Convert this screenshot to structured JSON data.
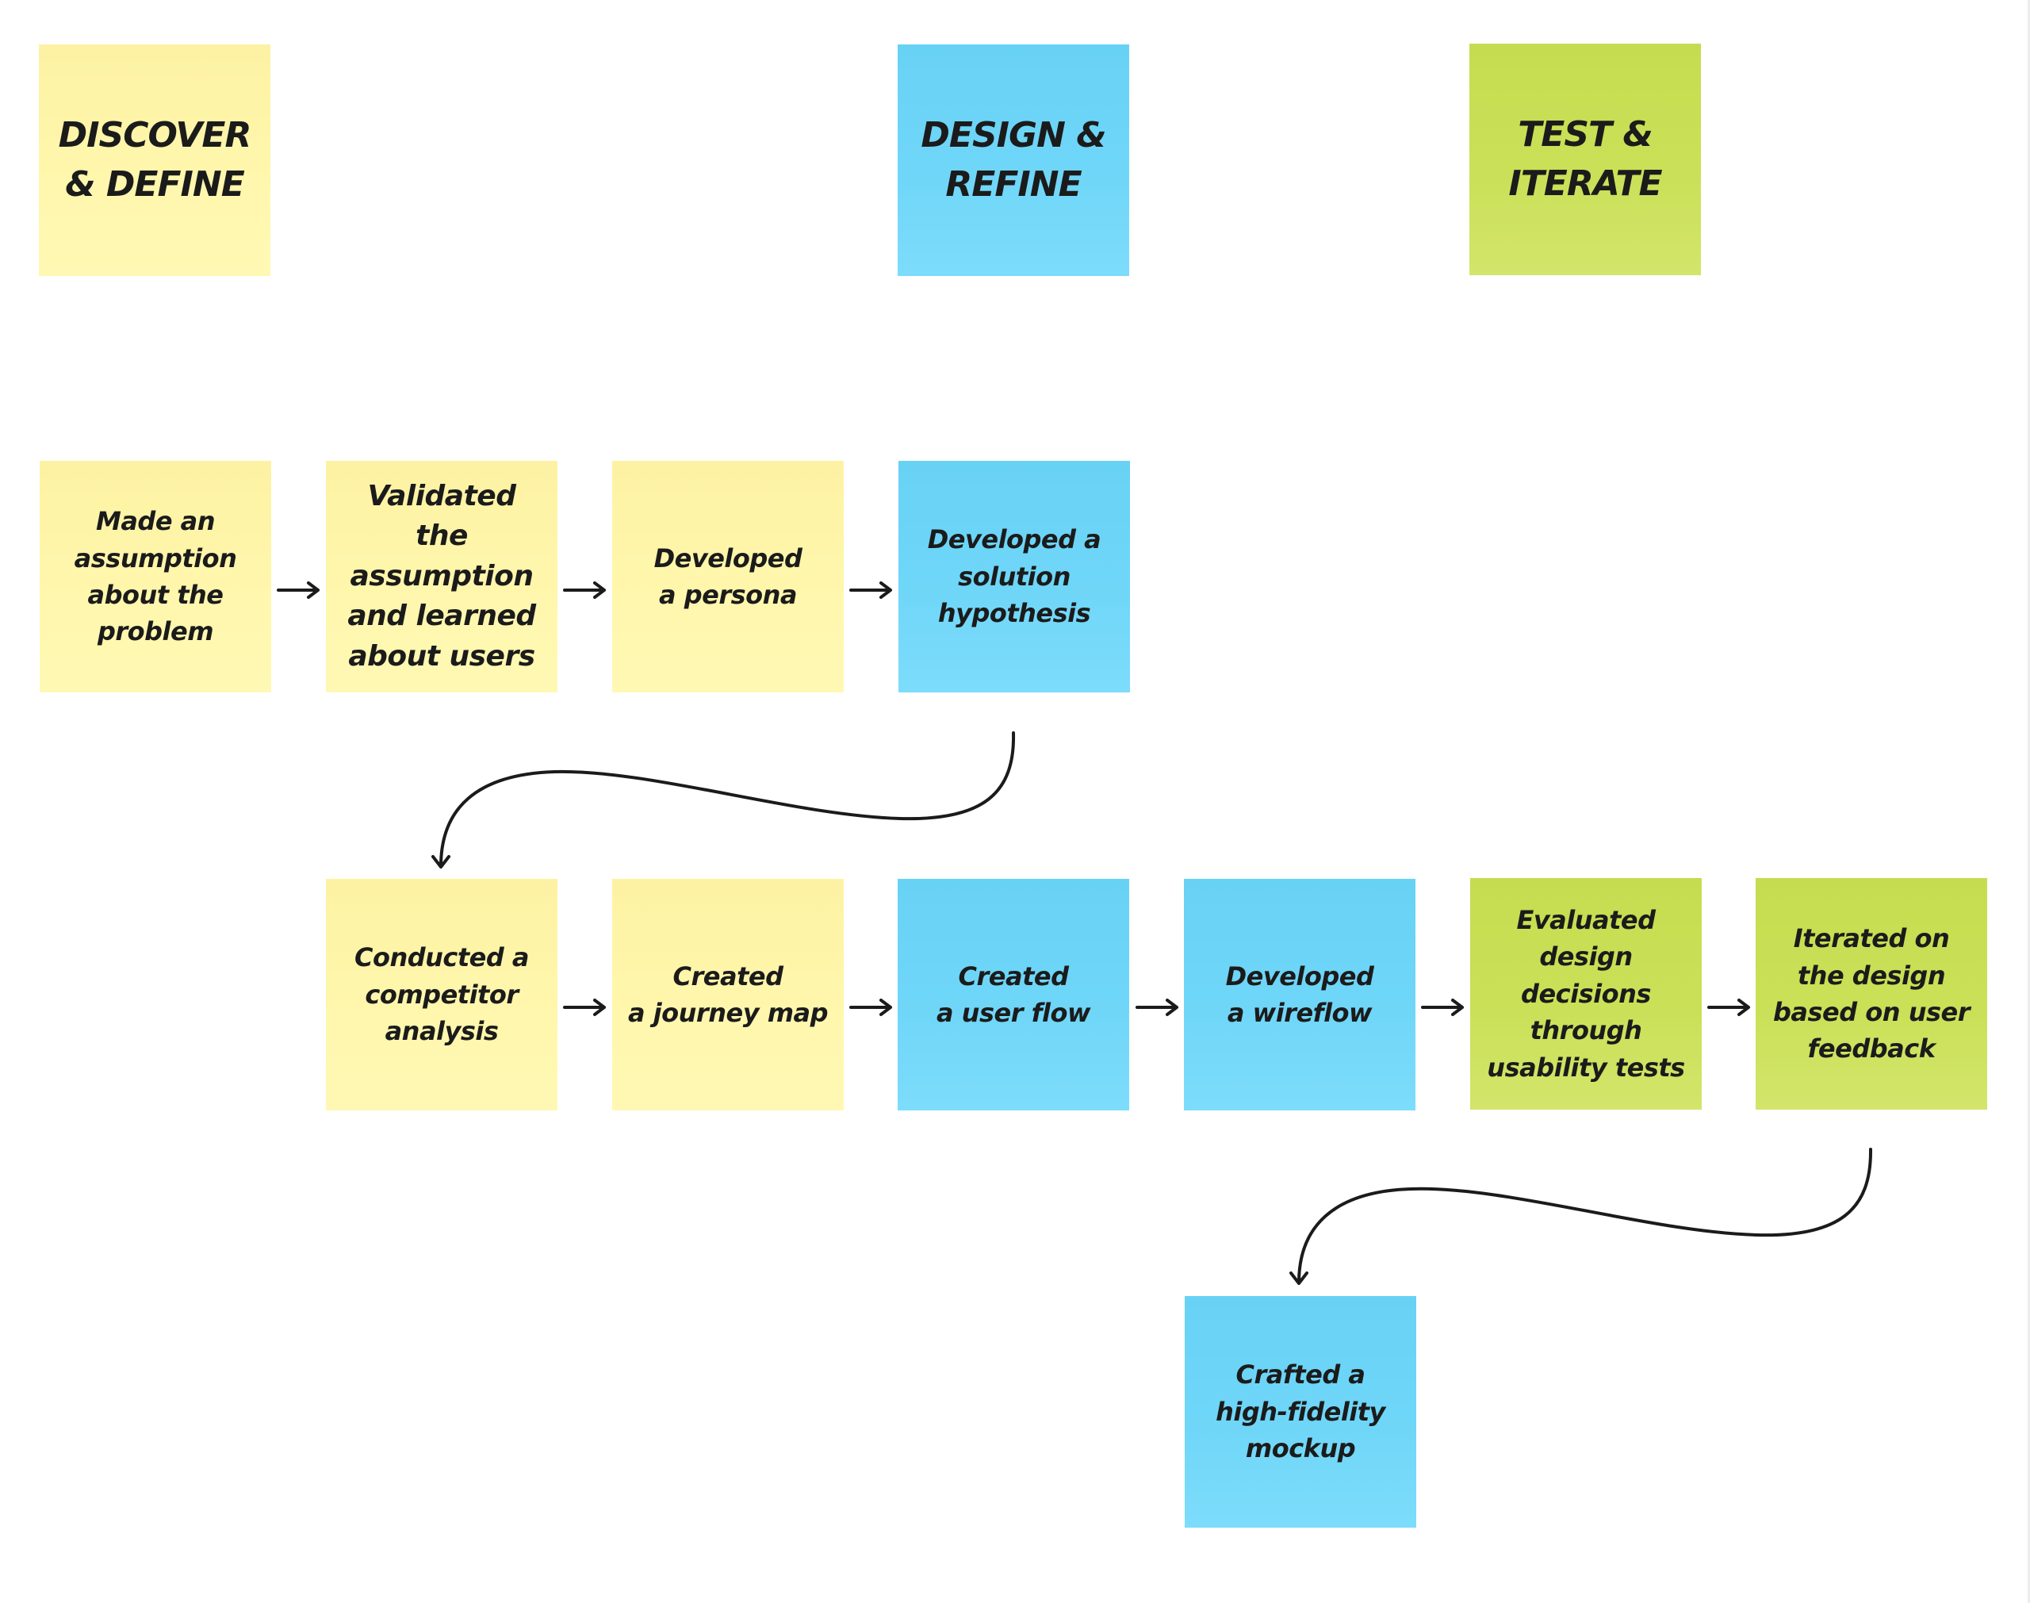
{
  "headers": [
    {
      "label": "DISCOVER\n& DEFINE",
      "color": "yellow"
    },
    {
      "label": "DESIGN &\nREFINE",
      "color": "blue"
    },
    {
      "label": "TEST &\nITERATE",
      "color": "green"
    }
  ],
  "steps": [
    {
      "label": "Made an\nassumption\nabout the\nproblem",
      "color": "yellow"
    },
    {
      "label": "Validated the\nassumption\nand learned\nabout users",
      "color": "yellow"
    },
    {
      "label": "Developed\na persona",
      "color": "yellow"
    },
    {
      "label": "Developed a\nsolution\nhypothesis",
      "color": "blue"
    },
    {
      "label": "Conducted a\ncompetitor\nanalysis",
      "color": "yellow"
    },
    {
      "label": "Created\na journey map",
      "color": "yellow"
    },
    {
      "label": "Created\na user flow",
      "color": "blue"
    },
    {
      "label": "Developed\na wireflow",
      "color": "blue"
    },
    {
      "label": "Evaluated\ndesign\ndecisions\nthrough\nusability tests",
      "color": "green"
    },
    {
      "label": "Iterated on\nthe design\nbased on user\nfeedback",
      "color": "green"
    },
    {
      "label": "Crafted a\nhigh-fidelity\nmockup",
      "color": "blue"
    }
  ],
  "connections": [
    {
      "from": "Made an assumption about the problem",
      "to": "Validated the assumption and learned about users",
      "type": "straight-arrow"
    },
    {
      "from": "Validated the assumption and learned about users",
      "to": "Developed a persona",
      "type": "straight-arrow"
    },
    {
      "from": "Developed a persona",
      "to": "Developed a solution hypothesis",
      "type": "straight-arrow"
    },
    {
      "from": "Developed a solution hypothesis",
      "to": "Conducted a competitor analysis",
      "type": "curved-arrow"
    },
    {
      "from": "Conducted a competitor analysis",
      "to": "Created a journey map",
      "type": "straight-arrow"
    },
    {
      "from": "Created a journey map",
      "to": "Created a user flow",
      "type": "straight-arrow"
    },
    {
      "from": "Created a user flow",
      "to": "Developed a wireflow",
      "type": "straight-arrow"
    },
    {
      "from": "Developed a wireflow",
      "to": "Evaluated design decisions through usability tests",
      "type": "straight-arrow"
    },
    {
      "from": "Evaluated design decisions through usability tests",
      "to": "Iterated on the design based on user feedback",
      "type": "straight-arrow"
    },
    {
      "from": "Iterated on the design based on user feedback",
      "to": "Crafted a high-fidelity mockup",
      "type": "curved-arrow"
    }
  ],
  "colors": {
    "yellow": "#fff7a8",
    "blue": "#6fd5f7",
    "green": "#c9de55",
    "ink": "#1b1b1b"
  }
}
